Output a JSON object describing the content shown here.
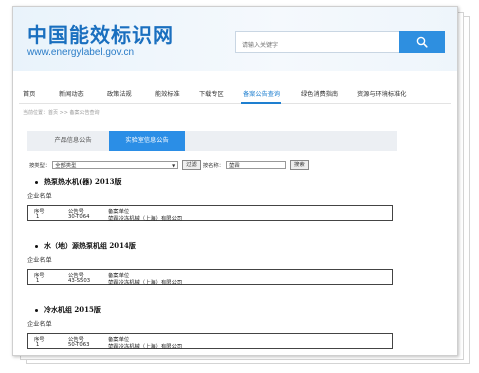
{
  "site": {
    "logo_text": "中国能效标识网",
    "url_text": "www.energylabel.gov.cn",
    "search_placeholder": "请输入关键字"
  },
  "nav": {
    "items": [
      "首页",
      "新闻动态",
      "政策法规",
      "能效标准",
      "下载专区",
      "备案公告查询",
      "绿色消费指南",
      "资源与环境标准化"
    ],
    "active_index": 5
  },
  "breadcrumb": "当前位置：首页 >> 备案公告查询",
  "tabs": {
    "product": "产品信息公告",
    "lab": "实验室信息公告",
    "active": "lab"
  },
  "filter": {
    "type_label": "按类型：",
    "type_value": "全部类型",
    "filter_button": "过滤",
    "keyword_label": "按名称：",
    "keyword_value": "堃霖",
    "search_button": "搜索"
  },
  "sections": [
    {
      "title": "热泵热水机(器) 2013版",
      "company_heading": "企业名单",
      "headers": [
        "序号",
        "公告号",
        "备案单位"
      ],
      "row": [
        "1",
        "30-T064",
        "堃霖冷冻机械（上海）有限公司"
      ]
    },
    {
      "title": "水（地）源热泵机组 2014版",
      "company_heading": "企业名单",
      "headers": [
        "序号",
        "公告号",
        "备案单位"
      ],
      "row": [
        "1",
        "43-S503",
        "堃霖冷冻机械（上海）有限公司"
      ]
    },
    {
      "title": "冷水机组 2015版",
      "company_heading": "企业名单",
      "headers": [
        "序号",
        "公告号",
        "备案单位"
      ],
      "row": [
        "1",
        "50-T063",
        "堃霖冷冻机械（上海）有限公司"
      ]
    }
  ],
  "colors": {
    "brand_blue": "#1a6fbf",
    "accent_blue": "#2b8ee6"
  },
  "icons": {
    "search": "search-icon"
  }
}
